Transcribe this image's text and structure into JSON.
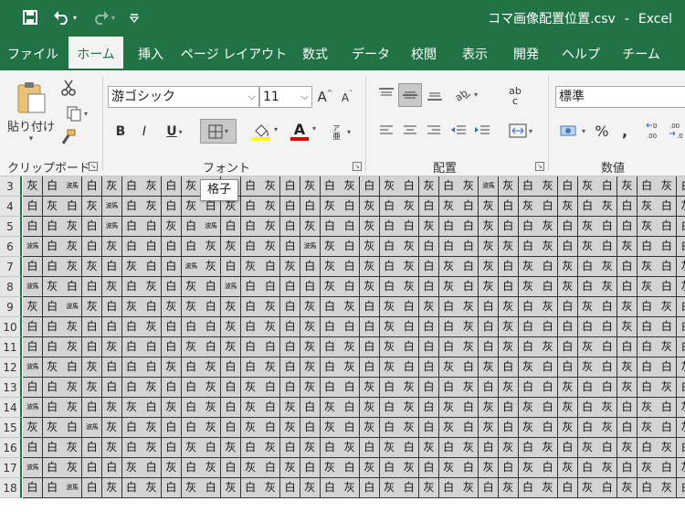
{
  "title": {
    "filename": "コマ画像配置位置.csv",
    "separator": "-",
    "app": "Excel"
  },
  "qat": {
    "save_icon": "save-icon",
    "undo_icon": "undo-icon",
    "redo_icon": "redo-icon",
    "customize_icon": "customize-qat-icon"
  },
  "tabs": [
    "ファイル",
    "ホーム",
    "挿入",
    "ページ レイアウト",
    "数式",
    "データ",
    "校閲",
    "表示",
    "開発",
    "ヘルプ",
    "チーム"
  ],
  "active_tab": "ホーム",
  "ribbon": {
    "clipboard": {
      "paste_label": "貼り付け",
      "paste_sub": "け",
      "group_label": "クリップボード"
    },
    "font": {
      "font_name": "游ゴシック",
      "font_size": "11",
      "bold": "B",
      "italic": "I",
      "underline": "U",
      "font_color_glyph": "A",
      "increase_font": "A",
      "decrease_font": "A",
      "fill_color": "#ffff00",
      "font_color": "#e00000",
      "group_label": "フォント"
    },
    "alignment": {
      "wrap_glyph": "ab",
      "wrap_sub": "c",
      "group_label": "配置"
    },
    "number": {
      "format": "標準",
      "percent": "%",
      "comma": ",",
      "group_label": "数値"
    }
  },
  "tooltip": "格子",
  "sheet": {
    "row_numbers": [
      "3",
      "4",
      "5",
      "6",
      "7",
      "8",
      "9",
      "10",
      "11",
      "12",
      "13",
      "14",
      "15",
      "16",
      "17",
      "18"
    ],
    "rows": [
      [
        "灰",
        "白",
        "波馬",
        "白",
        "灰",
        "白",
        "灰",
        "白",
        "灰",
        "波馬",
        "灰",
        "白",
        "灰",
        "白",
        "灰",
        "白",
        "灰",
        "白",
        "灰",
        "白",
        "灰",
        "白",
        "灰",
        "波馬",
        "灰",
        "白",
        "灰",
        "白",
        "灰",
        "白",
        "灰",
        "白",
        "灰",
        "白"
      ],
      [
        "白",
        "灰",
        "白",
        "灰",
        "波馬",
        "白",
        "灰",
        "白",
        "灰",
        "白",
        "灰",
        "白",
        "灰",
        "白",
        "白",
        "灰",
        "白",
        "灰",
        "白",
        "灰",
        "白",
        "灰",
        "白",
        "灰",
        "白",
        "灰",
        "白",
        "灰",
        "白",
        "灰",
        "白",
        "灰",
        "白",
        "灰"
      ],
      [
        "白",
        "白",
        "灰",
        "白",
        "波馬",
        "白",
        "白",
        "灰",
        "白",
        "波馬",
        "白",
        "白",
        "灰",
        "白",
        "灰",
        "白",
        "白",
        "灰",
        "白",
        "白",
        "灰",
        "白",
        "白",
        "灰",
        "白",
        "白",
        "灰",
        "白",
        "灰",
        "白",
        "白",
        "灰",
        "白",
        "白"
      ],
      [
        "波馬",
        "白",
        "灰",
        "白",
        "灰",
        "白",
        "白",
        "白",
        "白",
        "灰",
        "灰",
        "白",
        "灰",
        "白",
        "波馬",
        "灰",
        "白",
        "灰",
        "白",
        "灰",
        "白",
        "白",
        "白",
        "灰",
        "灰",
        "白",
        "灰",
        "白",
        "灰",
        "白",
        "灰",
        "白",
        "白",
        "白"
      ],
      [
        "白",
        "白",
        "灰",
        "灰",
        "白",
        "灰",
        "白",
        "白",
        "波馬",
        "灰",
        "白",
        "灰",
        "白",
        "灰",
        "白",
        "灰",
        "白",
        "灰",
        "白",
        "灰",
        "白",
        "灰",
        "白",
        "灰",
        "白",
        "灰",
        "白",
        "灰",
        "白",
        "灰",
        "白",
        "灰",
        "白",
        "灰"
      ],
      [
        "波馬",
        "灰",
        "白",
        "白",
        "灰",
        "白",
        "灰",
        "白",
        "灰",
        "白",
        "波馬",
        "白",
        "白",
        "白",
        "白",
        "灰",
        "白",
        "灰",
        "白",
        "灰",
        "白",
        "灰",
        "白",
        "灰",
        "白",
        "灰",
        "白",
        "灰",
        "白",
        "灰",
        "白",
        "灰",
        "白",
        "灰"
      ],
      [
        "灰",
        "白",
        "波馬",
        "灰",
        "白",
        "灰",
        "白",
        "灰",
        "灰",
        "白",
        "灰",
        "白",
        "灰",
        "白",
        "灰",
        "白",
        "灰",
        "白",
        "灰",
        "白",
        "灰",
        "白",
        "灰",
        "白",
        "灰",
        "白",
        "灰",
        "白",
        "灰",
        "白",
        "灰",
        "白",
        "灰",
        "白"
      ],
      [
        "白",
        "白",
        "灰",
        "白",
        "白",
        "白",
        "灰",
        "白",
        "白",
        "白",
        "灰",
        "白",
        "灰",
        "白",
        "灰",
        "白",
        "白",
        "白",
        "灰",
        "白",
        "白",
        "白",
        "灰",
        "白",
        "灰",
        "白",
        "白",
        "白",
        "白",
        "白",
        "灰",
        "白",
        "白",
        "白"
      ],
      [
        "白",
        "白",
        "灰",
        "白",
        "灰",
        "白",
        "白",
        "白",
        "灰",
        "白",
        "灰",
        "白",
        "白",
        "白",
        "灰",
        "白",
        "灰",
        "白",
        "灰",
        "白",
        "白",
        "白",
        "灰",
        "白",
        "灰",
        "白",
        "灰",
        "白",
        "灰",
        "白",
        "白",
        "白",
        "灰",
        "白"
      ],
      [
        "波馬",
        "灰",
        "白",
        "灰",
        "白",
        "白",
        "白",
        "灰",
        "白",
        "灰",
        "白",
        "白",
        "灰",
        "白",
        "灰",
        "白",
        "灰",
        "白",
        "灰",
        "白",
        "白",
        "灰",
        "白",
        "灰",
        "白",
        "灰",
        "白",
        "白",
        "灰",
        "白",
        "灰",
        "白",
        "白",
        "灰"
      ],
      [
        "白",
        "白",
        "灰",
        "灰",
        "白",
        "白",
        "灰",
        "白",
        "白",
        "灰",
        "白",
        "灰",
        "白",
        "白",
        "灰",
        "白",
        "白",
        "灰",
        "白",
        "灰",
        "白",
        "白",
        "灰",
        "白",
        "灰",
        "白",
        "白",
        "灰",
        "白",
        "白",
        "灰",
        "白",
        "灰",
        "白"
      ],
      [
        "波馬",
        "白",
        "灰",
        "白",
        "灰",
        "灰",
        "白",
        "灰",
        "白",
        "灰",
        "白",
        "灰",
        "白",
        "灰",
        "白",
        "灰",
        "白",
        "灰",
        "白",
        "灰",
        "白",
        "灰",
        "白",
        "灰",
        "白",
        "灰",
        "白",
        "灰",
        "白",
        "灰",
        "白",
        "灰",
        "白",
        "灰"
      ],
      [
        "灰",
        "灰",
        "白",
        "波馬",
        "灰",
        "白",
        "灰",
        "白",
        "白",
        "灰",
        "白",
        "灰",
        "白",
        "灰",
        "白",
        "灰",
        "白",
        "灰",
        "白",
        "灰",
        "白",
        "灰",
        "白",
        "灰",
        "白",
        "灰",
        "白",
        "灰",
        "白",
        "灰",
        "白",
        "灰",
        "白",
        "灰"
      ],
      [
        "白",
        "白",
        "灰",
        "白",
        "灰",
        "白",
        "灰",
        "白",
        "灰",
        "白",
        "灰",
        "白",
        "灰",
        "白",
        "灰",
        "白",
        "灰",
        "白",
        "灰",
        "白",
        "灰",
        "白",
        "灰",
        "白",
        "灰",
        "白",
        "灰",
        "白",
        "灰",
        "白",
        "灰",
        "白",
        "灰",
        "白"
      ],
      [
        "波馬",
        "白",
        "灰",
        "白",
        "白",
        "灰",
        "白",
        "灰",
        "白",
        "灰",
        "白",
        "灰",
        "白",
        "灰",
        "白",
        "灰",
        "白",
        "灰",
        "白",
        "灰",
        "白",
        "灰",
        "白",
        "灰",
        "白",
        "灰",
        "白",
        "灰",
        "白",
        "灰",
        "白",
        "灰",
        "白",
        "灰"
      ],
      [
        "白",
        "白",
        "波馬",
        "白",
        "灰",
        "白",
        "灰",
        "白",
        "灰",
        "白",
        "灰",
        "白",
        "灰",
        "白",
        "灰",
        "白",
        "灰",
        "白",
        "灰",
        "白",
        "灰",
        "白",
        "灰",
        "白",
        "灰",
        "白",
        "灰",
        "白",
        "灰",
        "白",
        "灰",
        "白",
        "灰",
        "白"
      ]
    ]
  }
}
